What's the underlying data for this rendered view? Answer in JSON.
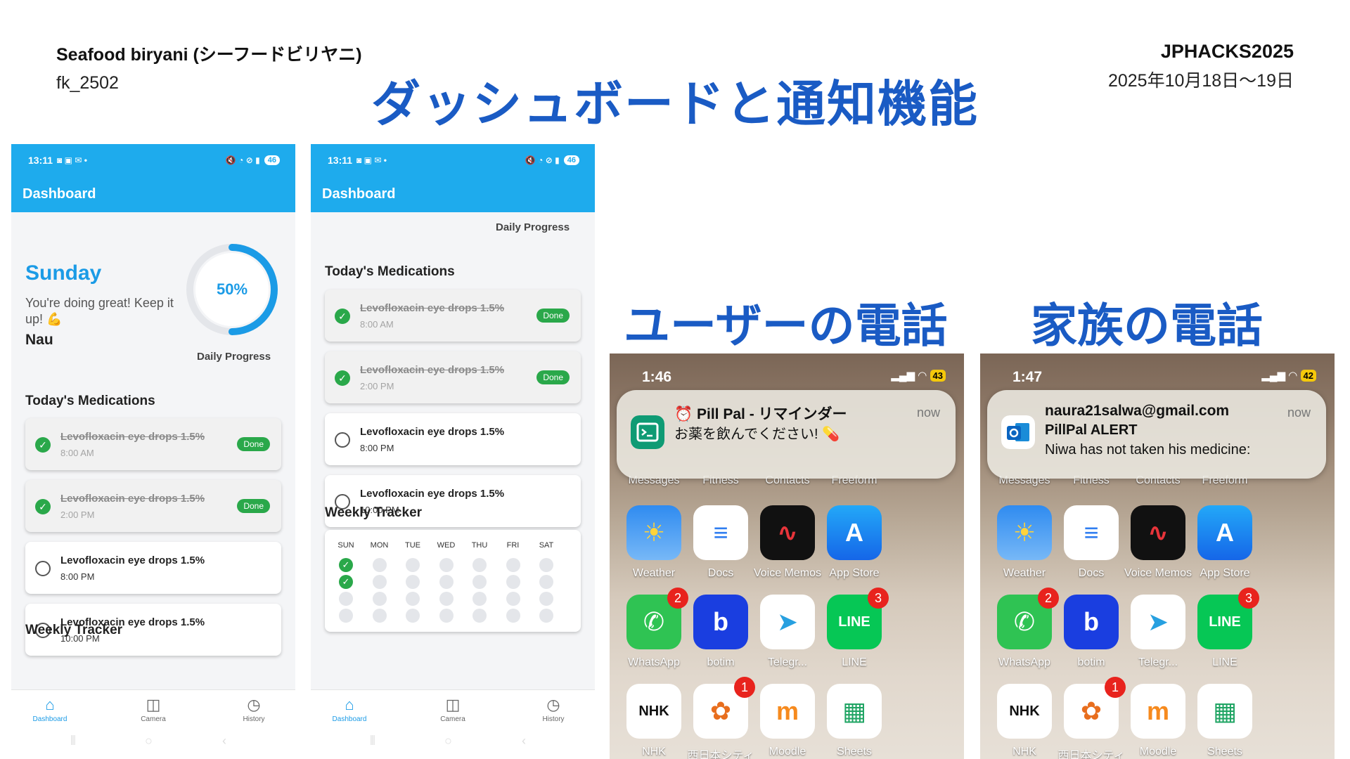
{
  "header": {
    "team_name": "Seafood biryani (シーフードビリヤニ)",
    "team_id": "fk_2502",
    "event": "JPHACKS2025",
    "dates": "2025年10月18日〜19日",
    "title": "ダッシュボードと通知機能"
  },
  "section_titles": {
    "user_phone": "ユーザーの電話",
    "family_phone": "家族の電話"
  },
  "android_status": {
    "time": "13:11",
    "battery": "46"
  },
  "dashboard": {
    "app_title": "Dashboard",
    "day": "Sunday",
    "encouragement": "You're doing great! Keep it up! 💪",
    "user_name": "Nau",
    "progress_percent": 50,
    "progress_label": "50%",
    "progress_caption": "Daily Progress",
    "medications_title": "Today's Medications",
    "done_label": "Done",
    "medications": [
      {
        "name": "Levofloxacin eye drops 1.5%",
        "time": "8:00 AM",
        "done": true
      },
      {
        "name": "Levofloxacin eye drops 1.5%",
        "time": "2:00 PM",
        "done": true
      },
      {
        "name": "Levofloxacin eye drops 1.5%",
        "time": "8:00 PM",
        "done": false
      },
      {
        "name": "Levofloxacin eye drops 1.5%",
        "time": "10:00 PM",
        "done": false
      }
    ],
    "weekly_title": "Weekly Tracker",
    "week_days": [
      "SUN",
      "MON",
      "TUE",
      "WED",
      "THU",
      "FRI",
      "SAT"
    ],
    "week_sunday_taken": 2,
    "week_dot_rows": 4,
    "nav": [
      "Dashboard",
      "Camera",
      "History"
    ]
  },
  "user_phone": {
    "time": "1:46",
    "battery": "43",
    "notification": {
      "app": "Pill Pal - リマインダー",
      "message": "お薬を飲んでください! 💊",
      "when": "now"
    }
  },
  "family_phone": {
    "time": "1:47",
    "battery": "42",
    "notification": {
      "sender": "naura21salwa@gmail.com",
      "subject": "PillPal ALERT",
      "message": "Niwa has not taken his medicine:",
      "when": "now"
    }
  },
  "home_screen": {
    "top_row_labels": [
      "Messages",
      "Fitness",
      "Contacts",
      "Freeform"
    ],
    "row2": [
      "Weather",
      "Docs",
      "Voice Memos",
      "App Store"
    ],
    "row3": [
      "WhatsApp",
      "botim",
      "Telegr...",
      "LINE"
    ],
    "row4": [
      "NHK",
      "西日本シティ",
      "Moodle",
      "Sheets"
    ],
    "whatsapp_badge": "2",
    "line_badge": "3",
    "bank_badge": "1"
  }
}
